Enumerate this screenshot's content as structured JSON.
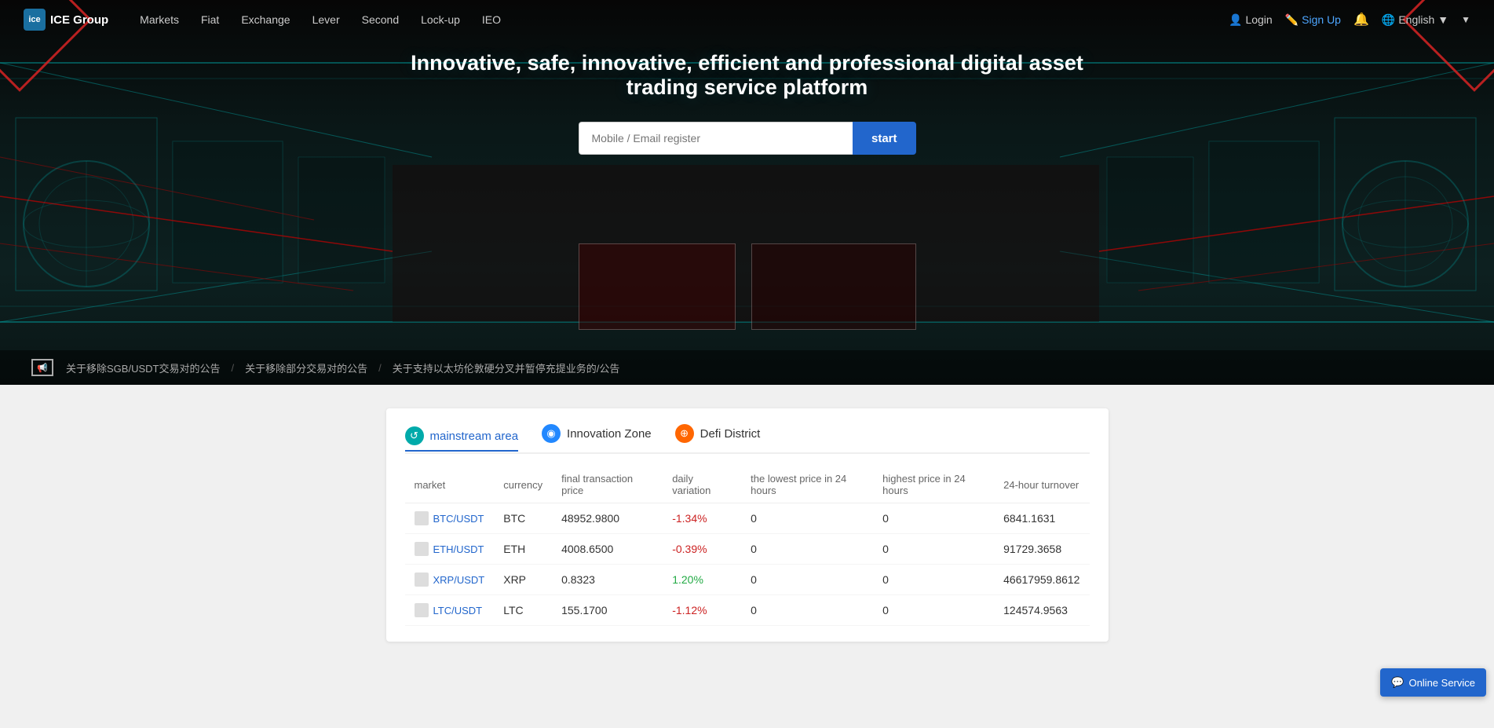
{
  "brand": {
    "logo_text": "ice",
    "name": "ICE Group"
  },
  "navbar": {
    "links": [
      {
        "label": "Markets",
        "id": "markets"
      },
      {
        "label": "Fiat",
        "id": "fiat"
      },
      {
        "label": "Exchange",
        "id": "exchange"
      },
      {
        "label": "Lever",
        "id": "lever"
      },
      {
        "label": "Second",
        "id": "second"
      },
      {
        "label": "Lock-up",
        "id": "lockup"
      },
      {
        "label": "IEO",
        "id": "ieo"
      }
    ],
    "login": "Login",
    "signup": "Sign Up",
    "language": "English"
  },
  "hero": {
    "title": "Innovative, safe, innovative, efficient and professional digital asset trading service platform",
    "register_placeholder": "Mobile / Email register",
    "register_btn": "start"
  },
  "announcements": [
    {
      "text": "关于移除SGB/USDT交易对的公告"
    },
    {
      "text": "关于移除部分交易对的公告"
    },
    {
      "text": "关于支持以太坊伦敦硬分叉并暂停充提业务的/公告"
    }
  ],
  "market": {
    "tabs": [
      {
        "label": "mainstream area",
        "icon": "~",
        "color": "teal",
        "active": true
      },
      {
        "label": "Innovation Zone",
        "icon": "◉",
        "color": "blue",
        "active": false
      },
      {
        "label": "Defi District",
        "icon": "⊕",
        "color": "orange",
        "active": false
      }
    ],
    "columns": [
      {
        "label": "market"
      },
      {
        "label": "currency"
      },
      {
        "label": "final transaction price"
      },
      {
        "label": "daily variation"
      },
      {
        "label": "the lowest price in 24 hours"
      },
      {
        "label": "highest price in 24 hours"
      },
      {
        "label": "24-hour turnover"
      }
    ],
    "rows": [
      {
        "pair": "BTC/USDT",
        "currency": "BTC",
        "price": "48952.9800",
        "change": "-1.34%",
        "low24": "0",
        "high24": "0",
        "turnover": "6841.1631",
        "change_type": "neg"
      },
      {
        "pair": "ETH/USDT",
        "currency": "ETH",
        "price": "4008.6500",
        "change": "-0.39%",
        "low24": "0",
        "high24": "0",
        "turnover": "91729.3658",
        "change_type": "neg"
      },
      {
        "pair": "XRP/USDT",
        "currency": "XRP",
        "price": "0.8323",
        "change": "1.20%",
        "low24": "0",
        "high24": "0",
        "turnover": "46617959.8612",
        "change_type": "pos"
      },
      {
        "pair": "LTC/USDT",
        "currency": "LTC",
        "price": "155.1700",
        "change": "-1.12%",
        "low24": "0",
        "high24": "0",
        "turnover": "124574.9563",
        "change_type": "neg"
      }
    ]
  },
  "online_service": {
    "label": "Online Service",
    "icon": "💬"
  }
}
